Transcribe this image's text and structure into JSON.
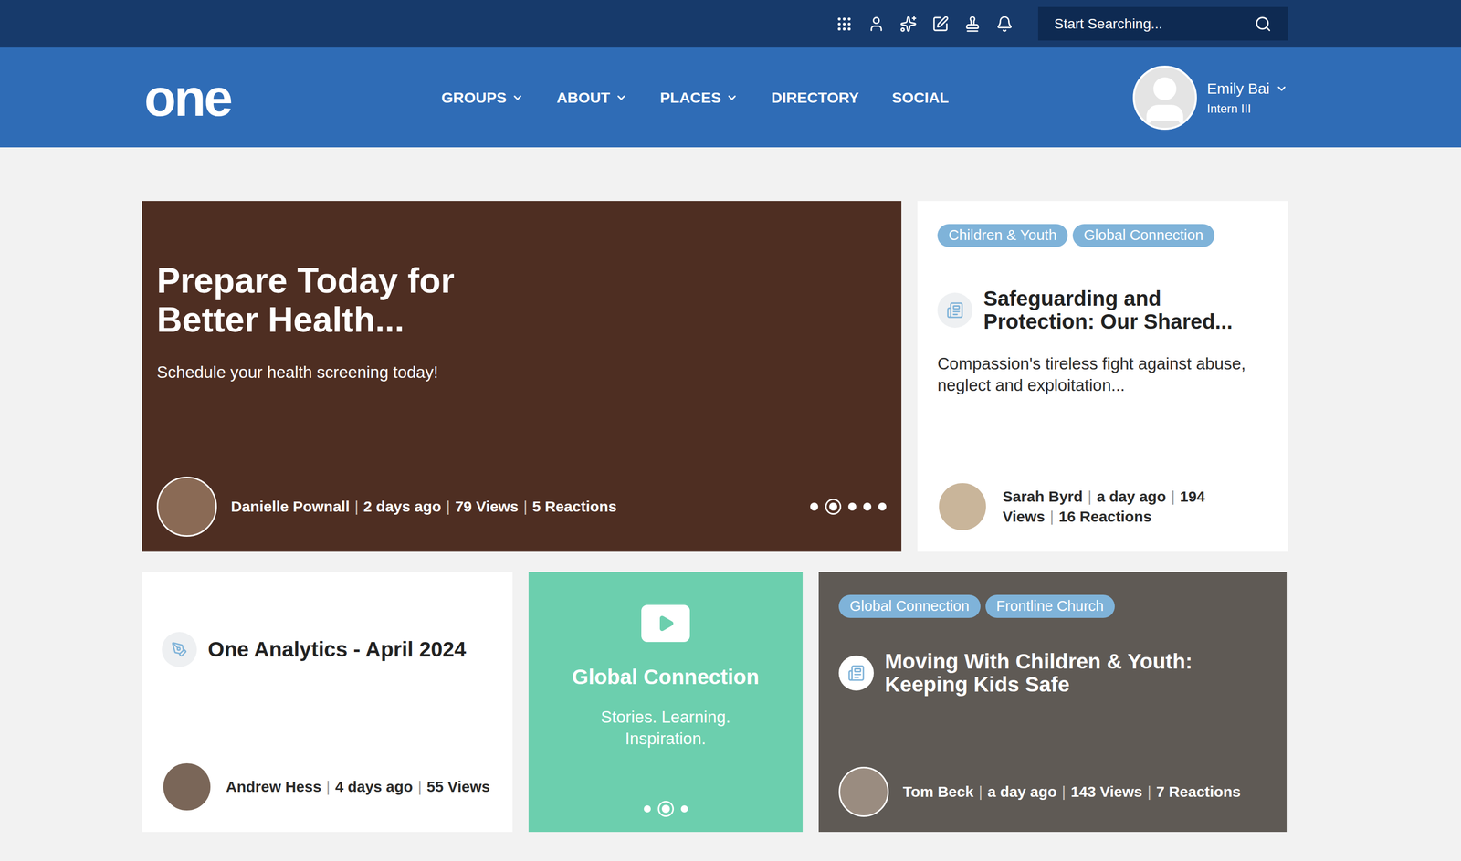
{
  "topbar": {
    "search": {
      "placeholder": "Start Searching..."
    }
  },
  "nav": {
    "logo": "one",
    "items": [
      {
        "label": "GROUPS",
        "dropdown": true
      },
      {
        "label": "ABOUT",
        "dropdown": true
      },
      {
        "label": "PLACES",
        "dropdown": true
      },
      {
        "label": "DIRECTORY",
        "dropdown": false
      },
      {
        "label": "SOCIAL",
        "dropdown": false
      }
    ],
    "user": {
      "name": "Emily Bai",
      "role": "Intern III"
    }
  },
  "separator": "|",
  "hero": {
    "title": "Prepare Today for Better Health...",
    "subtitle": "Schedule your health screening today!",
    "author": "Danielle Pownall",
    "meta": [
      "2 days ago",
      "79 Views",
      "5 Reactions"
    ],
    "slides": [
      {
        "selected": false
      },
      {
        "selected": true
      },
      {
        "selected": false
      },
      {
        "selected": false
      },
      {
        "selected": false
      }
    ]
  },
  "featured": {
    "tags": [
      "Children & Youth",
      "Global Connection"
    ],
    "title": "Safeguarding and Protection: Our Shared...",
    "description": "Compassion's tireless fight against abuse, neglect and exploitation...",
    "author": "Sarah Byrd",
    "meta": [
      "a day ago",
      "194 Views",
      "16 Reactions"
    ]
  },
  "analytics": {
    "title": "One Analytics - April 2024",
    "author": "Andrew Hess",
    "meta": [
      "4 days ago",
      "55 Views"
    ]
  },
  "promo": {
    "title": "Global Connection",
    "subtitle": "Stories. Learning. Inspiration.",
    "slides": [
      {
        "selected": false
      },
      {
        "selected": true
      },
      {
        "selected": false
      }
    ]
  },
  "video": {
    "tags": [
      "Global Connection",
      "Frontline Church"
    ],
    "title": "Moving With Children & Youth: Keeping Kids Safe",
    "author": "Tom Beck",
    "meta": [
      "a day ago",
      "143 Views",
      "7 Reactions"
    ]
  }
}
